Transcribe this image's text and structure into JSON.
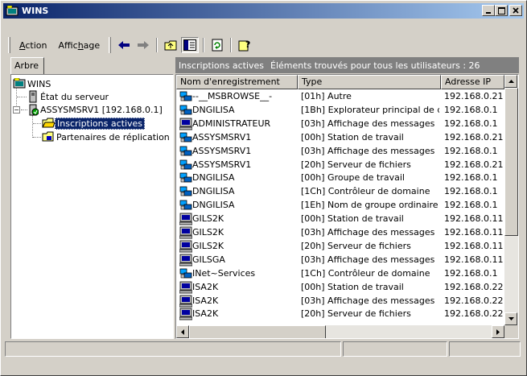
{
  "window": {
    "title": "WINS",
    "controls": {
      "minimize": "_",
      "maximize": "□",
      "close": "✕"
    }
  },
  "menu": {
    "action_label": "Action",
    "view_label": "Affichage"
  },
  "toolbar": {
    "icons": [
      "back-icon",
      "forward-icon",
      "up-folder-icon",
      "show-hide-tree-icon",
      "refresh-icon",
      "help-icon"
    ]
  },
  "left_panel": {
    "tab_label": "Arbre",
    "tree": {
      "root": "WINS",
      "server_status": "État du serveur",
      "server": "ASSYSMSRV1 [192.168.0.1]",
      "active_registrations": "Inscriptions actives",
      "replication_partners": "Partenaires de réplication"
    }
  },
  "right_panel": {
    "header_title": "Inscriptions actives",
    "header_info": "Éléments trouvés pour tous les utilisateurs : 26",
    "columns": [
      "Nom d'enregistrement",
      "Type",
      "Adresse IP"
    ],
    "rows": [
      {
        "name": "--__MSBROWSE__-",
        "type": "[01h] Autre",
        "ip": "192.168.0.21",
        "icon": "group-icon"
      },
      {
        "name": "DNGILISA",
        "type": "[1Bh] Explorateur principal de d...",
        "ip": "192.168.0.1",
        "icon": "group-icon"
      },
      {
        "name": "ADMINISTRATEUR",
        "type": "[03h] Affichage des messages",
        "ip": "192.168.0.1",
        "icon": "computer-icon"
      },
      {
        "name": "ASSYSMSRV1",
        "type": "[00h] Station de travail",
        "ip": "192.168.0.21",
        "icon": "group-icon"
      },
      {
        "name": "ASSYSMSRV1",
        "type": "[03h] Affichage des messages",
        "ip": "192.168.0.1",
        "icon": "group-icon"
      },
      {
        "name": "ASSYSMSRV1",
        "type": "[20h] Serveur de fichiers",
        "ip": "192.168.0.21",
        "icon": "group-icon"
      },
      {
        "name": "DNGILISA",
        "type": "[00h] Groupe de travail",
        "ip": "192.168.0.1",
        "icon": "group-icon"
      },
      {
        "name": "DNGILISA",
        "type": "[1Ch] Contrôleur de domaine",
        "ip": "192.168.0.1",
        "icon": "group-icon"
      },
      {
        "name": "DNGILISA",
        "type": "[1Eh] Nom de groupe ordinaire",
        "ip": "192.168.0.1",
        "icon": "group-icon"
      },
      {
        "name": "GILS2K",
        "type": "[00h] Station de travail",
        "ip": "192.168.0.11",
        "icon": "computer-icon"
      },
      {
        "name": "GILS2K",
        "type": "[03h] Affichage des messages",
        "ip": "192.168.0.11",
        "icon": "computer-icon"
      },
      {
        "name": "GILS2K",
        "type": "[20h] Serveur de fichiers",
        "ip": "192.168.0.11",
        "icon": "computer-icon"
      },
      {
        "name": "GILSGA",
        "type": "[03h] Affichage des messages",
        "ip": "192.168.0.11",
        "icon": "computer-icon"
      },
      {
        "name": "INet~Services",
        "type": "[1Ch] Contrôleur de domaine",
        "ip": "192.168.0.1",
        "icon": "group-icon"
      },
      {
        "name": "ISA2K",
        "type": "[00h] Station de travail",
        "ip": "192.168.0.22",
        "icon": "computer-icon"
      },
      {
        "name": "ISA2K",
        "type": "[03h] Affichage des messages",
        "ip": "192.168.0.22",
        "icon": "computer-icon"
      },
      {
        "name": "ISA2K",
        "type": "[20h] Serveur de fichiers",
        "ip": "192.168.0.22",
        "icon": "computer-icon"
      }
    ]
  },
  "colors": {
    "title_start": "#0a246a",
    "title_end": "#a6caf0",
    "selection": "#0a246a",
    "face": "#d4d0c8"
  }
}
